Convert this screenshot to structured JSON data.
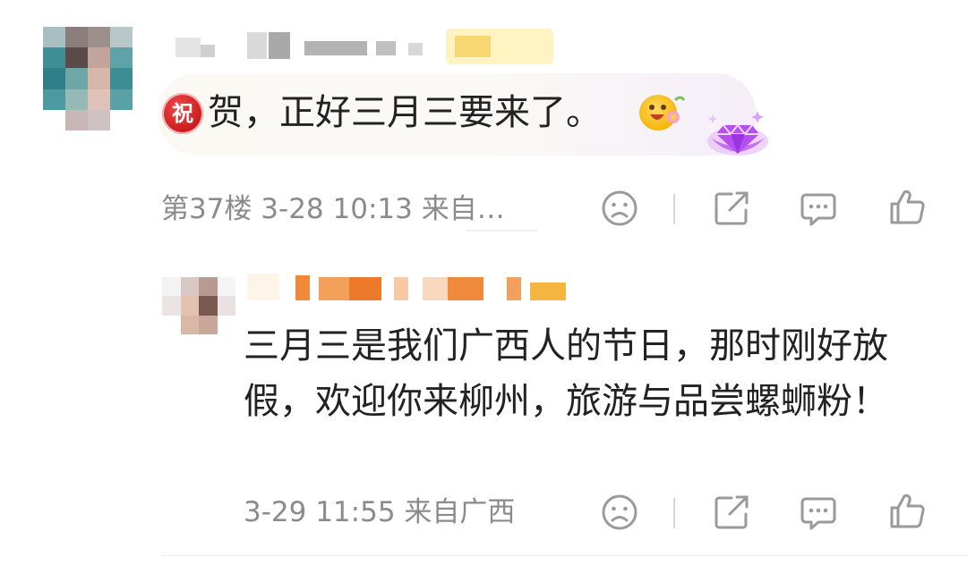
{
  "main_comment": {
    "badge": "祝",
    "text": "贺，正好三月三要来了。",
    "meta": "第37楼 3-28 10:13 来自…"
  },
  "reply": {
    "text": "三月三是我们广西人的节日，那时刚好放假，欢迎你来柳州，旅游与品尝螺蛳粉！",
    "meta": "3-29 11:55 来自广西"
  },
  "actions": [
    "dislike-face-icon",
    "share-icon",
    "comment-icon",
    "like-thumb-icon"
  ],
  "colors": {
    "meta": "#8b8b8b",
    "text": "#222222",
    "icon": "#9a9a9a",
    "badge": "#d32525"
  }
}
